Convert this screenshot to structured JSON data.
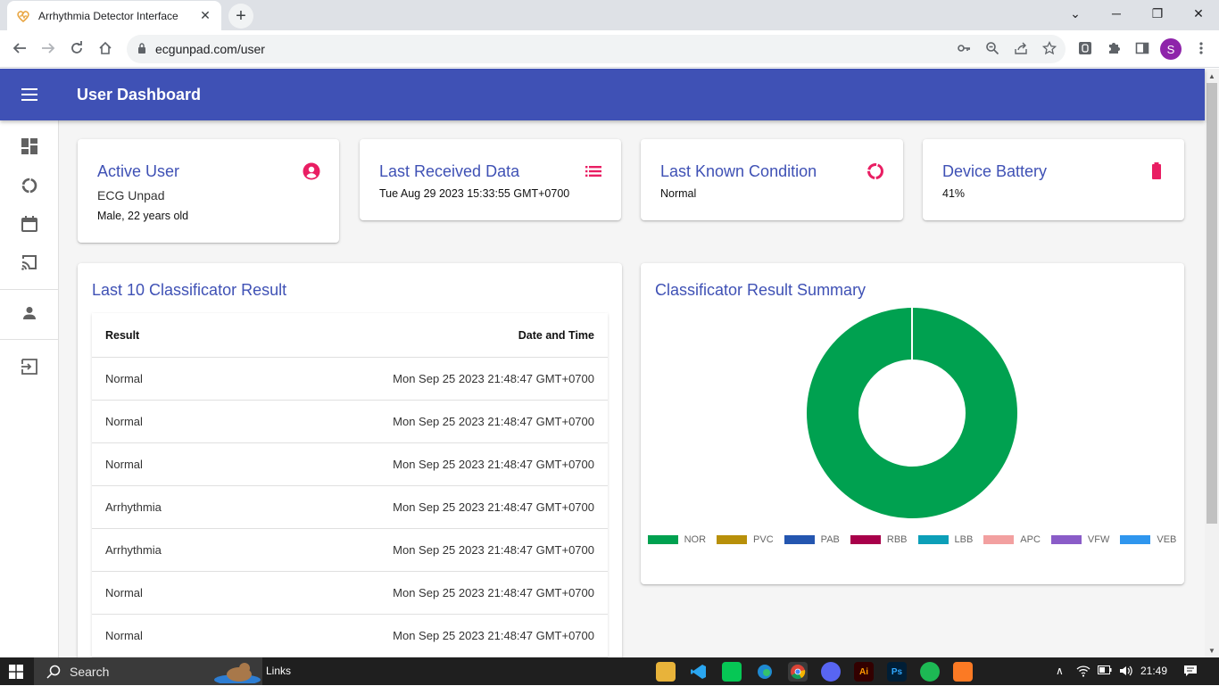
{
  "browser": {
    "tab_title": "Arrhythmia Detector Interface",
    "tab_close": "✕",
    "new_tab": "+",
    "url": "ecgunpad.com/user",
    "profile_initial": "S",
    "window_controls": {
      "minimize": "─",
      "restore": "❐",
      "close": "✕",
      "tab_list": "⌄"
    }
  },
  "app": {
    "title": "User Dashboard",
    "accent": "#3f51b5",
    "icon_accent": "#e91e63"
  },
  "cards": {
    "active_user": {
      "title": "Active User",
      "name": "ECG Unpad",
      "detail": "Male, 22 years old"
    },
    "last_received": {
      "title": "Last Received Data",
      "value": "Tue Aug 29 2023 15:33:55 GMT+0700"
    },
    "last_condition": {
      "title": "Last Known Condition",
      "value": "Normal"
    },
    "battery": {
      "title": "Device Battery",
      "value": "41%",
      "level": 0.41
    }
  },
  "results": {
    "title": "Last 10 Classificator Result",
    "headers": {
      "result": "Result",
      "datetime": "Date and Time"
    },
    "rows": [
      {
        "result": "Normal",
        "datetime": "Mon Sep 25 2023 21:48:47 GMT+0700"
      },
      {
        "result": "Normal",
        "datetime": "Mon Sep 25 2023 21:48:47 GMT+0700"
      },
      {
        "result": "Normal",
        "datetime": "Mon Sep 25 2023 21:48:47 GMT+0700"
      },
      {
        "result": "Arrhythmia",
        "datetime": "Mon Sep 25 2023 21:48:47 GMT+0700"
      },
      {
        "result": "Arrhythmia",
        "datetime": "Mon Sep 25 2023 21:48:47 GMT+0700"
      },
      {
        "result": "Normal",
        "datetime": "Mon Sep 25 2023 21:48:47 GMT+0700"
      },
      {
        "result": "Normal",
        "datetime": "Mon Sep 25 2023 21:48:47 GMT+0700"
      }
    ]
  },
  "summary": {
    "title": "Classificator Result Summary"
  },
  "chart_data": {
    "type": "pie",
    "donut": true,
    "categories": [
      "NOR",
      "PVC",
      "PAB",
      "RBB",
      "LBB",
      "APC",
      "VFW",
      "VEB"
    ],
    "values": [
      100,
      0,
      0,
      0,
      0,
      0,
      0,
      0
    ],
    "colors": [
      "#00a150",
      "#b8900a",
      "#2456b0",
      "#a8004a",
      "#0c9fb8",
      "#f2a0a0",
      "#8a5cc8",
      "#2f96ee"
    ],
    "legend": "bottom",
    "title": ""
  },
  "taskbar": {
    "search_placeholder": "Search",
    "links_label": "Links",
    "time": "21:49"
  }
}
